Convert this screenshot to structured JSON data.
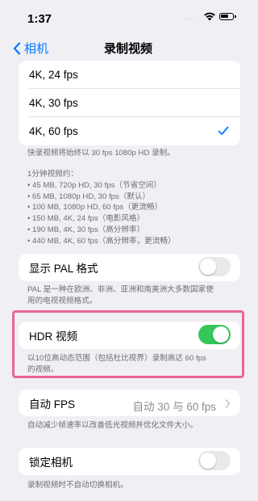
{
  "status_bar": {
    "time": "1:37",
    "dots": "....",
    "wifi_icon": "wifi-icon",
    "battery_icon": "battery-icon"
  },
  "nav": {
    "back_label": "相机",
    "title": "录制视频",
    "back_icon": "chevron-left-icon"
  },
  "resolution_options": [
    {
      "label": "4K, 24 fps",
      "selected": false
    },
    {
      "label": "4K, 30 fps",
      "selected": false
    },
    {
      "label": "4K, 60 fps",
      "selected": true
    }
  ],
  "quick_video_note": "快录视频将始终以 30 fps 1080p HD 录制。",
  "per_minute": {
    "heading": "1分钟视频约：",
    "lines": [
      "• 45 MB, 720p HD, 30 fps（节省空间）",
      "• 65 MB, 1080p HD, 30 fps（默认）",
      "• 100 MB, 1080p HD, 60 fps（更流畅）",
      "• 150 MB, 4K, 24 fps（电影风格）",
      "• 190 MB, 4K, 30 fps（高分辨率）",
      "• 440 MB, 4K, 60 fps（高分辨率，更流畅）"
    ]
  },
  "pal": {
    "label": "显示 PAL 格式",
    "on": false,
    "note_lines": [
      "PAL 是一种在欧洲、非洲、亚洲和南美洲大多数国家使",
      "用的电视视频格式。"
    ]
  },
  "hdr": {
    "label": "HDR 视频",
    "on": true,
    "note_lines": [
      "以10位高动态范围（包括杜比视界）录制高达 60 fps",
      "的视频。"
    ]
  },
  "auto_fps": {
    "label": "自动 FPS",
    "value": "自动 30 与 60 fps",
    "note": "自动减少帧速率以改善低光视频并优化文件大小。"
  },
  "lock_camera": {
    "label": "锁定相机",
    "on": false,
    "note": "录制视频时不自动切换相机。"
  },
  "colors": {
    "accent": "#007aff",
    "toggle_on": "#34c759",
    "highlight": "#e96597",
    "background": "#efeff4"
  }
}
